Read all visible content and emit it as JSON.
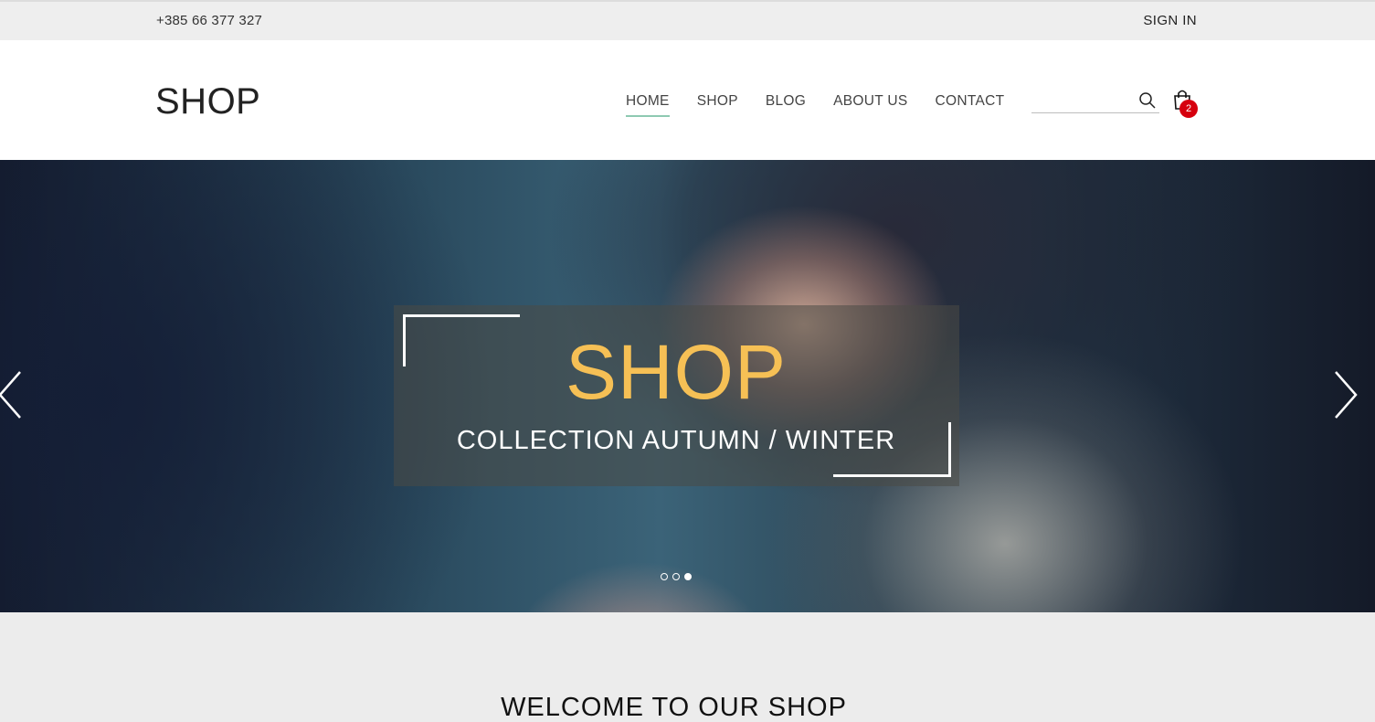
{
  "topbar": {
    "phone": "+385 66 377 327",
    "signin_label": "SIGN IN"
  },
  "header": {
    "logo": "SHOP",
    "nav": [
      {
        "label": "HOME",
        "active": true
      },
      {
        "label": "SHOP"
      },
      {
        "label": "BLOG"
      },
      {
        "label": "ABOUT US"
      },
      {
        "label": "CONTACT"
      }
    ],
    "search": {
      "placeholder": "",
      "icon": "search-icon"
    },
    "cart": {
      "icon": "shopping-bag-icon",
      "count": "2"
    }
  },
  "hero": {
    "title": "SHOP",
    "subtitle": "COLLECTION AUTUMN / WINTER",
    "slides_total": 3,
    "active_slide": 3,
    "title_color": "#f6c055"
  },
  "welcome": {
    "heading": "WELCOME TO OUR SHOP"
  },
  "colors": {
    "nav_active_underline": "#8ec9b2",
    "cart_badge": "#d6000e"
  }
}
